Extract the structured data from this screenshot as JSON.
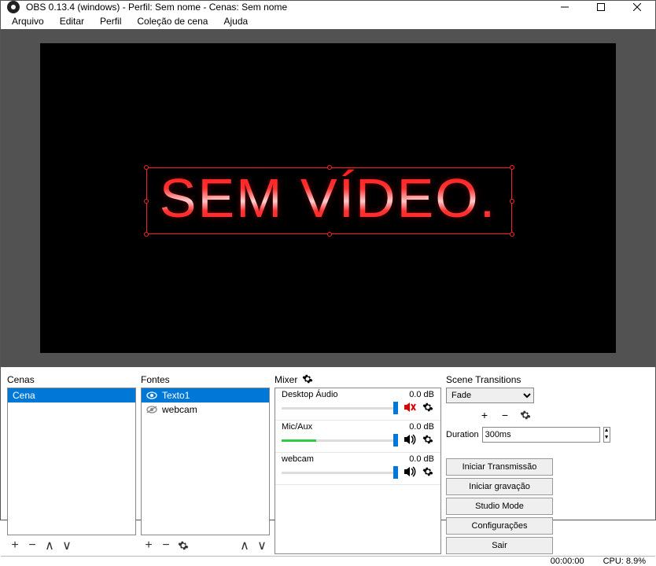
{
  "window": {
    "title": "OBS 0.13.4 (windows) - Perfil: Sem nome - Cenas: Sem nome"
  },
  "menu": {
    "arquivo": "Arquivo",
    "editar": "Editar",
    "perfil": "Perfil",
    "colecao": "Coleção de cena",
    "ajuda": "Ajuda"
  },
  "preview": {
    "text": "SEM VÍDEO."
  },
  "scenes": {
    "header": "Cenas",
    "items": [
      "Cena"
    ]
  },
  "sources": {
    "header": "Fontes",
    "items": [
      {
        "name": "Texto1",
        "visible": true,
        "selected": true
      },
      {
        "name": "webcam",
        "visible": false,
        "selected": false
      }
    ]
  },
  "mixer": {
    "header": "Mixer",
    "channels": [
      {
        "name": "Desktop Áudio",
        "db": "0.0 dB",
        "muted": true,
        "level": 0,
        "thumb": 96
      },
      {
        "name": "Mic/Aux",
        "db": "0.0 dB",
        "muted": false,
        "level": 30,
        "thumb": 96
      },
      {
        "name": "webcam",
        "db": "0.0 dB",
        "muted": false,
        "level": 0,
        "thumb": 96
      }
    ]
  },
  "transitions": {
    "header": "Scene Transitions",
    "selected": "Fade",
    "duration_label": "Duration",
    "duration": "300ms"
  },
  "controls": {
    "start_stream": "Iniciar Transmissão",
    "start_record": "Iniciar gravação",
    "studio": "Studio Mode",
    "settings": "Configurações",
    "exit": "Sair"
  },
  "status": {
    "time": "00:00:00",
    "cpu": "CPU: 8.9%"
  }
}
